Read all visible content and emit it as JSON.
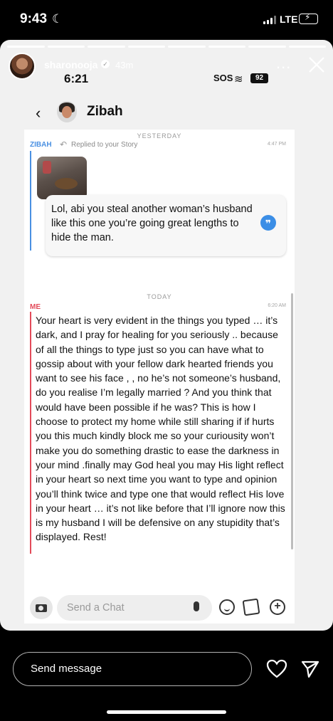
{
  "status_bar": {
    "time": "9:43",
    "network": "LTE"
  },
  "story": {
    "username": "sharonooja",
    "time_ago": "43m",
    "more_label": "...",
    "inner_status": {
      "time": "6:21",
      "sos": "SOS",
      "battery": "92"
    }
  },
  "chat": {
    "contact_name": "Zibah",
    "yesterday_label": "YESTERDAY",
    "zibah_label": "ZIBAH",
    "replied_label": "Replied to your Story",
    "zibah_time": "4:47 PM",
    "zibah_message": "Lol, abi you steal another woman’s husband like this one you’re going great lengths to hide the man.",
    "today_label": "TODAY",
    "me_label": "ME",
    "me_time": "6:20 AM",
    "me_message": "Your heart is very evident in the things you typed … it’s dark, and I pray for healing for you seriously .. because of all the things to type just so you can have what to gossip about with your fellow dark hearted friends you want to see his face , , no he’s not someone’s husband, do you realise I’m legally married ? And you think that would have been possible if he was? This is how I choose to protect my home while still sharing if if hurts you this much kindly block me so your curiousity won’t make you do something drastic to ease the darkness in your mind .finally may God heal you may His light reflect in your heart so next time you want to type and opinion you’ll think twice and type one that would reflect His love in your heart … it’s not like before that I’ll ignore now this is my husband I will be defensive on any stupidity that’s displayed. Rest!",
    "input_placeholder": "Send a Chat"
  },
  "bottom": {
    "send_message_placeholder": "Send message"
  },
  "colors": {
    "zibah": "#4a90e2",
    "me": "#e34b5a",
    "battery_fill": "#34c759"
  },
  "icons": [
    "moon-icon",
    "signal-icon",
    "battery-icon",
    "verified-icon",
    "more-icon",
    "close-icon",
    "back-icon",
    "quote-icon",
    "camera-icon",
    "mic-icon",
    "emoji-icon",
    "cards-icon",
    "plus-icon",
    "heart-icon",
    "send-icon"
  ]
}
